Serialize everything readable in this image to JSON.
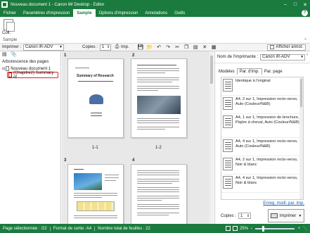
{
  "window": {
    "title": "Nouveau document 1 - Canon iW Desktop - Editor"
  },
  "menu": {
    "tabs": [
      {
        "label": "Fichier"
      },
      {
        "label": "Paramètres d'impression"
      },
      {
        "label": "Sample"
      },
      {
        "label": "Options d'impression"
      },
      {
        "label": "Annotations"
      },
      {
        "label": "Outils"
      }
    ]
  },
  "ribbon": {
    "coll_label": "Coll.",
    "group_label": "Sample"
  },
  "toolbar": {
    "imprimer_label": "Imprimer :",
    "printer_value": "Canon iR-ADV",
    "copies_label": "Copies :",
    "copies_value": "1",
    "imp_label": "Imp.",
    "afficher_label": "Afficher annot."
  },
  "left": {
    "heading": "Arborescence des pages",
    "doc_root": "Nouveau document 1",
    "child_sel": "(Chapitre2) Summary of"
  },
  "pages": [
    {
      "num": "1",
      "label": "1-1"
    },
    {
      "num": "2",
      "label": "1-2"
    },
    {
      "num": "3",
      "label": ""
    },
    {
      "num": "4",
      "label": ""
    }
  ],
  "page_texts": {
    "p1_heading": "Summary of Research"
  },
  "right": {
    "printer_label": "Nom de l'imprimante :",
    "printer_value": "Canon iR-ADV",
    "models_label": "Modèles",
    "tabs": [
      {
        "label": "Par. d'imp."
      },
      {
        "label": "Par. page"
      }
    ],
    "items": [
      {
        "text": "Identique à l'original"
      },
      {
        "text": "A4, 2 sur 1, Impression recto-verso, Auto (Couleur/N&B)"
      },
      {
        "text": "A4, 1 sur 1, Impression de brochure, Piqûre à cheval, Auto (Couleur/N&B)"
      },
      {
        "text": "A4, 4 sur 1, Impression recto-verso, Auto (Couleur/N&B)"
      },
      {
        "text": "A4, 2 sur 1, Impression recto-verso, Noir & blanc"
      },
      {
        "text": "A4, 4 sur 1, Impression recto-verso, Noir & blanc"
      }
    ],
    "reg_label": "Enreg. modl. par. imp.",
    "copies_label": "Copies :",
    "copies_value": "1",
    "print_button": "Imprimer"
  },
  "status": {
    "sel": "Page sélectionnée : /22",
    "format": "Format de sortie :A4",
    "total": "Nombre total de feuilles : 22",
    "zoom": "25%"
  },
  "colors": {
    "accent": "#1b7a3e",
    "highlight": "#e0201f"
  }
}
